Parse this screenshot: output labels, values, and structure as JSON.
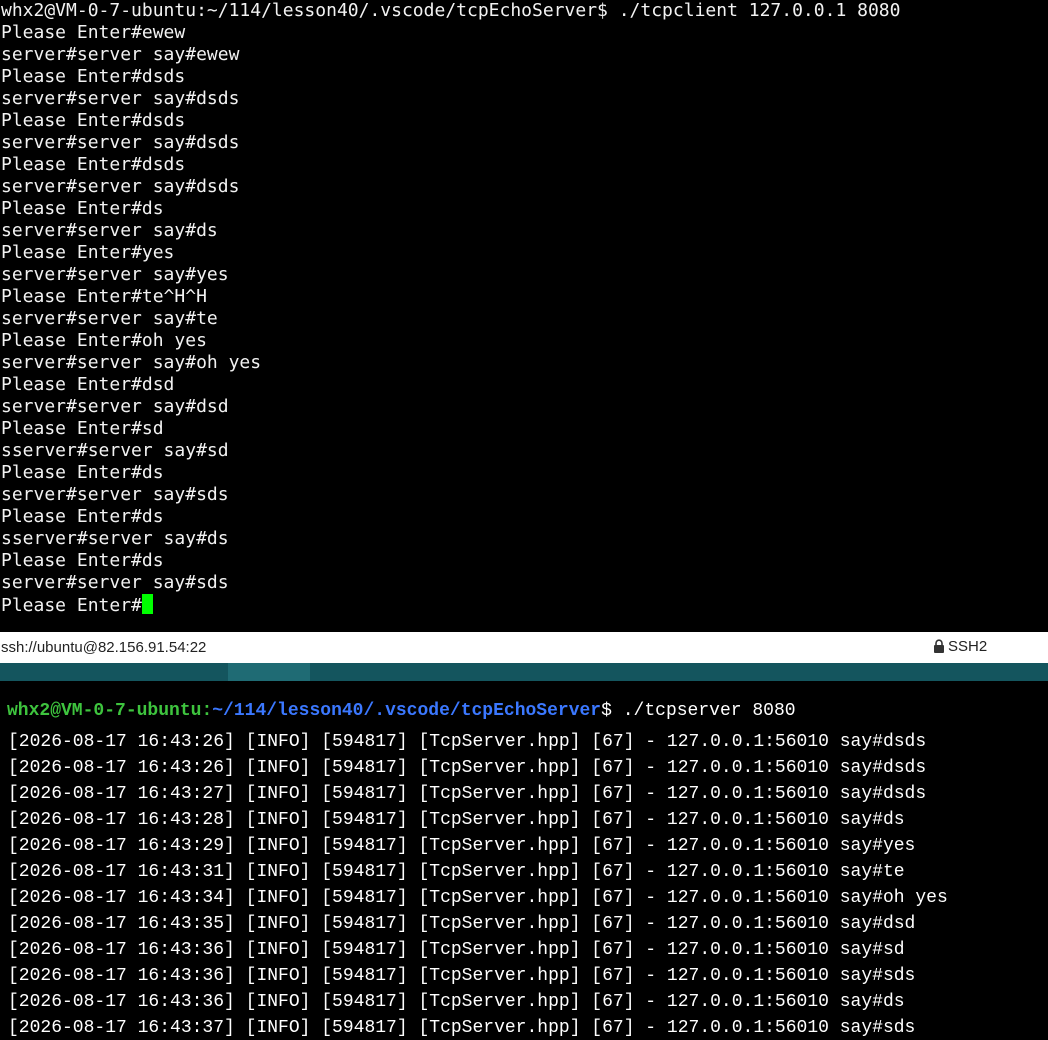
{
  "client_terminal": {
    "lines": [
      "whx2@VM-0-7-ubuntu:~/114/lesson40/.vscode/tcpEchoServer$ ./tcpclient 127.0.0.1 8080",
      "Please Enter#ewew",
      "server#server say#ewew",
      "Please Enter#dsds",
      "server#server say#dsds",
      "Please Enter#dsds",
      "server#server say#dsds",
      "Please Enter#dsds",
      "server#server say#dsds",
      "Please Enter#ds",
      "server#server say#ds",
      "Please Enter#yes",
      "server#server say#yes",
      "Please Enter#te^H^H",
      "server#server say#te",
      "Please Enter#oh yes",
      "server#server say#oh yes",
      "Please Enter#dsd",
      "server#server say#dsd",
      "Please Enter#sd",
      "sserver#server say#sd",
      "Please Enter#ds",
      "server#server say#sds",
      "Please Enter#ds",
      "sserver#server say#ds",
      "Please Enter#ds",
      "server#server say#sds"
    ],
    "current_prompt": "Please Enter#",
    "cursor_color": "#00ff00"
  },
  "status_bar": {
    "connection": "ssh://ubuntu@82.156.91.54:22",
    "protocol": "SSH2",
    "protocol_icon": "lock-icon"
  },
  "server_terminal": {
    "prompt_user": "whx2@VM-0-7-ubuntu",
    "prompt_colon": ":",
    "prompt_path": "~/114/lesson40/.vscode/tcpEchoServer",
    "prompt_dollar": "$",
    "command": " ./tcpserver 8080",
    "logs": [
      "[2026-08-17 16:43:26] [INFO] [594817] [TcpServer.hpp] [67] - 127.0.0.1:56010 say#dsds",
      "[2026-08-17 16:43:26] [INFO] [594817] [TcpServer.hpp] [67] - 127.0.0.1:56010 say#dsds",
      "[2026-08-17 16:43:27] [INFO] [594817] [TcpServer.hpp] [67] - 127.0.0.1:56010 say#dsds",
      "[2026-08-17 16:43:28] [INFO] [594817] [TcpServer.hpp] [67] - 127.0.0.1:56010 say#ds",
      "[2026-08-17 16:43:29] [INFO] [594817] [TcpServer.hpp] [67] - 127.0.0.1:56010 say#yes",
      "[2026-08-17 16:43:31] [INFO] [594817] [TcpServer.hpp] [67] - 127.0.0.1:56010 say#te",
      "[2026-08-17 16:43:34] [INFO] [594817] [TcpServer.hpp] [67] - 127.0.0.1:56010 say#oh yes",
      "[2026-08-17 16:43:35] [INFO] [594817] [TcpServer.hpp] [67] - 127.0.0.1:56010 say#dsd",
      "[2026-08-17 16:43:36] [INFO] [594817] [TcpServer.hpp] [67] - 127.0.0.1:56010 say#sd",
      "[2026-08-17 16:43:36] [INFO] [594817] [TcpServer.hpp] [67] - 127.0.0.1:56010 say#sds",
      "[2026-08-17 16:43:36] [INFO] [594817] [TcpServer.hpp] [67] - 127.0.0.1:56010 say#ds",
      "[2026-08-17 16:43:37] [INFO] [594817] [TcpServer.hpp] [67] - 127.0.0.1:56010 say#sds"
    ]
  },
  "colors": {
    "terminal_bg": "#000000",
    "divider": "#14555e",
    "prompt_user": "#3ec43e",
    "prompt_path": "#3b78ff"
  }
}
